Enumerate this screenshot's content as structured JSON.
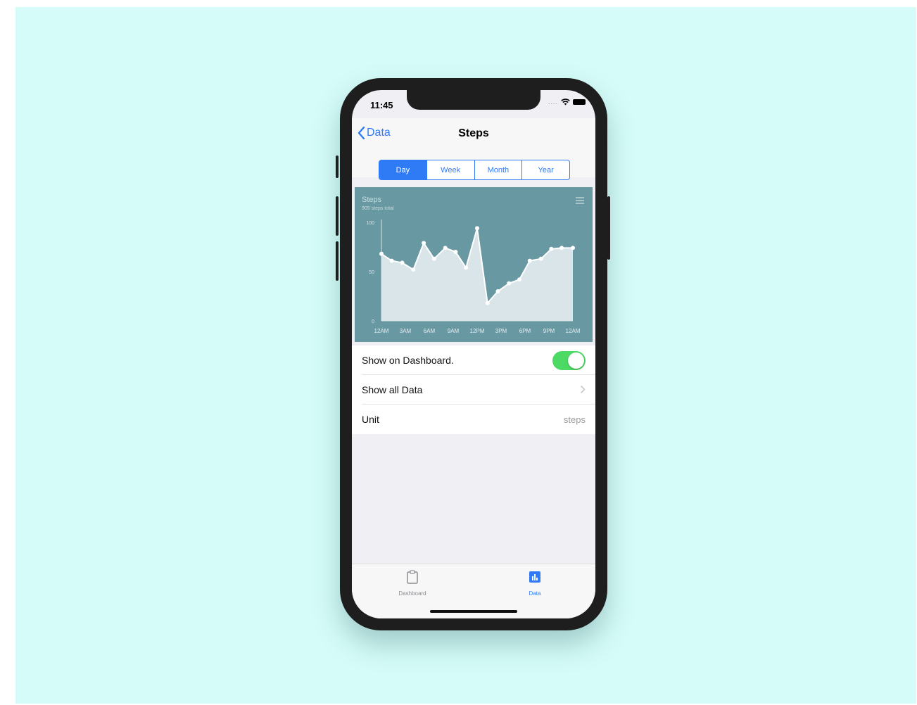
{
  "status_bar": {
    "time": "11:45",
    "signal": "...."
  },
  "nav": {
    "back_label": "Data",
    "title": "Steps"
  },
  "segments": [
    "Day",
    "Week",
    "Month",
    "Year"
  ],
  "selected_segment": "Day",
  "chart_data": {
    "type": "area",
    "title": "Steps",
    "subtitle": "905 steps total",
    "x_ticks": [
      "12AM",
      "3AM",
      "6AM",
      "9AM",
      "12PM",
      "3PM",
      "6PM",
      "9PM",
      "12AM"
    ],
    "y_ticks": [
      0,
      50,
      100
    ],
    "ylim": [
      0,
      100
    ],
    "xlim": [
      0,
      24
    ],
    "x": [
      0,
      1.3,
      2.6,
      4,
      5.3,
      6.6,
      8,
      9.3,
      10.6,
      12,
      13.3,
      14.6,
      16,
      17.3,
      18.6,
      20,
      21.3,
      22.6,
      24
    ],
    "y": [
      68,
      61,
      59,
      52,
      79,
      63,
      74,
      70,
      54,
      94,
      18,
      30,
      38,
      42,
      61,
      63,
      73,
      74,
      74
    ],
    "grid": false,
    "fill_color": "#d9e5e8",
    "line_color": "#ffffff",
    "background": "#6898a2"
  },
  "settings": {
    "show_on_dashboard": {
      "label": "Show on Dashboard.",
      "on": true
    },
    "show_all_data": {
      "label": "Show all Data"
    },
    "unit": {
      "label": "Unit",
      "value": "steps"
    }
  },
  "tabbar": {
    "tabs": [
      {
        "label": "Dashboard",
        "icon": "clipboard-icon",
        "active": false
      },
      {
        "label": "Data",
        "icon": "bar-chart-icon",
        "active": true
      }
    ]
  },
  "colors": {
    "accent": "#2f7bf5",
    "toggle_on": "#4cd964",
    "backdrop": "#d5fcf8",
    "inactive_tab": "#8e8e93"
  }
}
